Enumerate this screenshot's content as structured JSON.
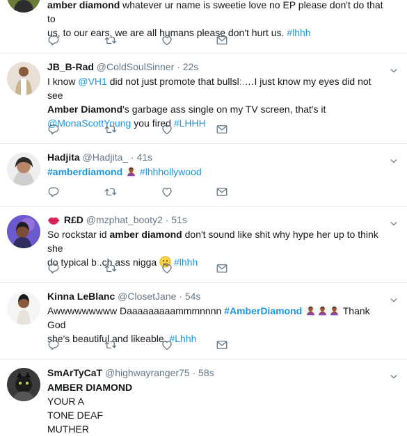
{
  "tweets": [
    {
      "name": "",
      "handle": "",
      "time": "",
      "line1_bold": "amber diamond",
      "line1_rest": " whatever ur name is sweetie love no EP please don't do that to",
      "line2": "us, to our ears, we are all humans please don't hurt us. ",
      "tag": "#lhhh"
    },
    {
      "name": "JB_B-Rad",
      "handle": "@ColdSoulSinner",
      "time": "· 22s",
      "t1": "I know ",
      "mention1": "@VH1",
      "t2": " did not just promote that bullsl",
      "t3": "…I just know my eyes did not see",
      "bold": "Amber Diamond",
      "t4": "'s garbage ass single on my TV screen, that's it",
      "mention2": "@MonaScottYoung",
      "t5": " you fired ",
      "tag": "#LHHH"
    },
    {
      "name": "Hadjita",
      "handle": "@Hadjita_",
      "time": "· 41s",
      "tag1": "#amberdiamond",
      "tag2": "#lhhhollywood"
    },
    {
      "name": "R£D",
      "handle": "@mzphat_booty2",
      "time": "· 51s",
      "t1": "So rockstar id ",
      "bold": "amber diamond",
      "t2": " don't sound like shit why hype her up to think she",
      "t3": "do typical b",
      "t4": ".ch ass nigga ",
      "tag": "#lhhh"
    },
    {
      "name": "Kinna LeBlanc",
      "handle": "@ClosetJane",
      "time": "· 54s",
      "t1": "Awwwwwwwww Daaaaaaaaammmnnnn ",
      "tag1": "#AmberDiamond",
      "t2": " Thank God",
      "t3": "she's beautiful and likeable. ",
      "tag2": "#Lhhh"
    },
    {
      "name": "SmArTyCaT",
      "handle": "@highwayranger75",
      "time": "· 58s",
      "line1": "AMBER DIAMOND",
      "line2": "YOUR A",
      "line3": "TONE DEAF",
      "line4": "MUTHER"
    }
  ],
  "icons": [
    "reply-icon",
    "retweet-icon",
    "like-icon",
    "message-icon",
    "chevron-down-icon"
  ],
  "colors": {
    "link": "#1b95e0",
    "muted": "#657786",
    "border": "#e6ecf0"
  }
}
